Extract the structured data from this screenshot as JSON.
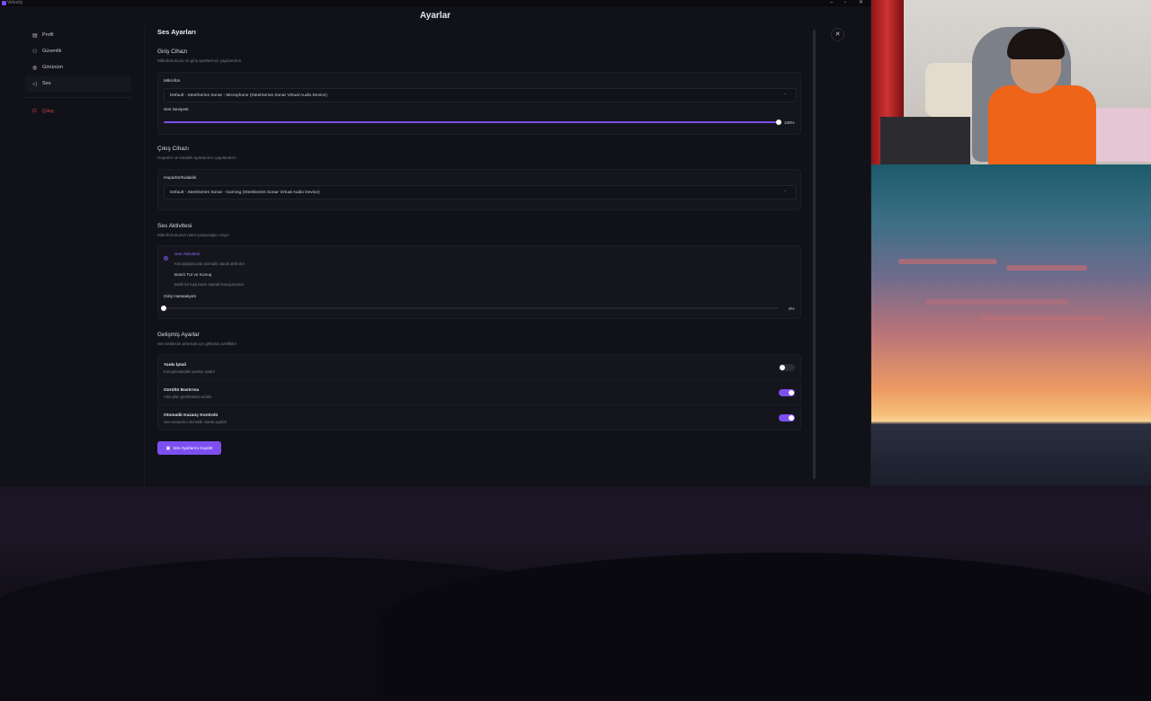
{
  "window": {
    "app_name": "Velocity",
    "title": "Ayarlar",
    "controls": [
      "–",
      "▫",
      "✕"
    ]
  },
  "sidebar": {
    "items": [
      {
        "label": "Profil",
        "icon": "id-card-icon"
      },
      {
        "label": "Güvenlik",
        "icon": "users-icon"
      },
      {
        "label": "Görünüm",
        "icon": "palette-icon"
      },
      {
        "label": "Ses",
        "icon": "speaker-icon",
        "active": true
      }
    ],
    "logout": {
      "label": "Çıkış",
      "icon": "power-icon"
    }
  },
  "main": {
    "page_title": "Ses Ayarları",
    "input": {
      "title": "Giriş Cihazı",
      "subtitle": "Mikrofonunuzu ve giriş ayarlarınızı yapılandırın",
      "mic_label": "Mikrofon",
      "mic_value": "Default - SteelSeries Sonar - Microphone (SteelSeries Sonar Virtual Audio Device)",
      "volume_label": "Ses Seviyesi",
      "volume_value_text": "100%",
      "volume_level": 1.0
    },
    "output": {
      "title": "Çıkış Cihazı",
      "subtitle": "Hoparlör ve kulaklık ayarlarınızı yapılandırın",
      "speaker_label": "Hoparlör/Kulaklık",
      "speaker_value": "Default - SteelSeries Sonar - Gaming (SteelSeries Sonar Virtual Audio Device)"
    },
    "activity": {
      "title": "Ses Aktivitesi",
      "subtitle": "Mikrofonunuzun nasıl çalışacağını seçin",
      "options": [
        {
          "title": "Ses Aktivitesi",
          "desc": "Konuştuğunuzda otomatik olarak aktif olur",
          "selected": true
        },
        {
          "title": "Basılı Tut ve Konuş",
          "desc": "Belirli bir tuşa basılı tutarak konuşursunuz",
          "selected": false
        }
      ],
      "sensitivity_label": "Giriş Hassasiyeti",
      "sensitivity_value_text": "0%",
      "sensitivity_level": 0.0
    },
    "advanced": {
      "title": "Gelişmiş Ayarlar",
      "subtitle": "Ses kalitesini artırmak için gelişmiş özellikler",
      "rows": [
        {
          "title": "Yankı İptali",
          "desc": "Konuşmalardaki yankıyı azaltır",
          "on": false
        },
        {
          "title": "Gürültü Bastırma",
          "desc": "Arka plan gürültüsünü azaltır",
          "on": true
        },
        {
          "title": "Otomatik Kazanç Kontrolü",
          "desc": "Ses seviyesini otomatik olarak ayarlar",
          "on": true
        }
      ]
    },
    "save_label": "Ses Ayarlarını Kaydet"
  },
  "colors": {
    "accent": "#7d4ff0",
    "danger": "#e0484f",
    "background": "#111118"
  }
}
